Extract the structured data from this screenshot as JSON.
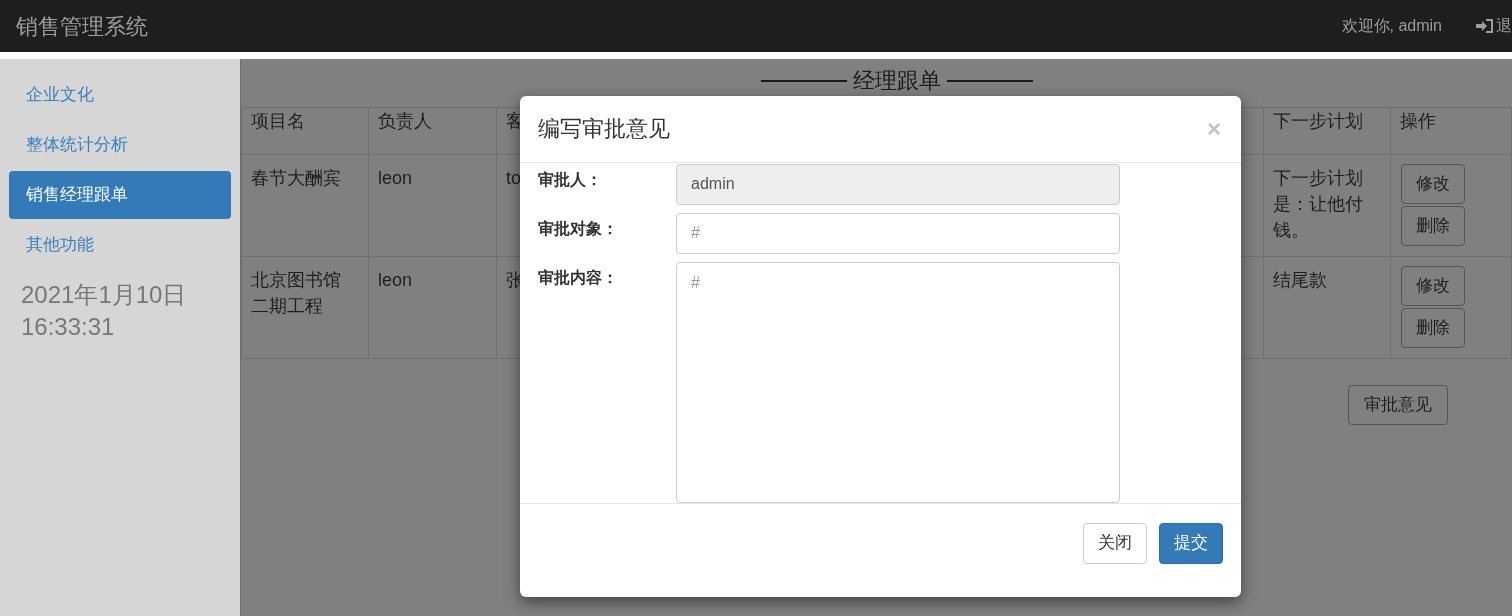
{
  "navbar": {
    "brand": "销售管理系统",
    "welcome": "欢迎你, admin",
    "logout": "退"
  },
  "sidebar": {
    "items": [
      {
        "label": "企业文化",
        "selected": false
      },
      {
        "label": "整体统计分析",
        "selected": false
      },
      {
        "label": "销售经理跟单",
        "selected": true
      },
      {
        "label": "其他功能",
        "selected": false
      }
    ],
    "date": "2021年1月10日",
    "time": "16:33:31"
  },
  "page": {
    "heading": "经理跟单",
    "table": {
      "columns": [
        "项目名",
        "负责人",
        "客",
        "下一步计划",
        "操作"
      ],
      "rows": [
        {
          "cells": [
            "春节大酬宾",
            "leon",
            "to",
            "下一步计划是：让他付钱。"
          ],
          "actions": [
            "修改",
            "删除"
          ]
        },
        {
          "cells": [
            "北京图书馆二期工程",
            "leon",
            "张",
            "结尾款"
          ],
          "actions": [
            "修改",
            "删除"
          ]
        }
      ]
    },
    "approve_button": "审批意见"
  },
  "modal": {
    "title": "编写审批意见",
    "close": "×",
    "fields": [
      {
        "kind": "input",
        "label": "审批人：",
        "value": "admin",
        "disabled": true
      },
      {
        "kind": "input",
        "label": "审批对象：",
        "placeholder": "#",
        "disabled": false
      },
      {
        "kind": "textarea",
        "label": "审批内容：",
        "placeholder": "#",
        "disabled": false
      }
    ],
    "buttons": [
      {
        "label": "关闭",
        "kind": "default"
      },
      {
        "label": "提交",
        "kind": "primary"
      }
    ]
  }
}
